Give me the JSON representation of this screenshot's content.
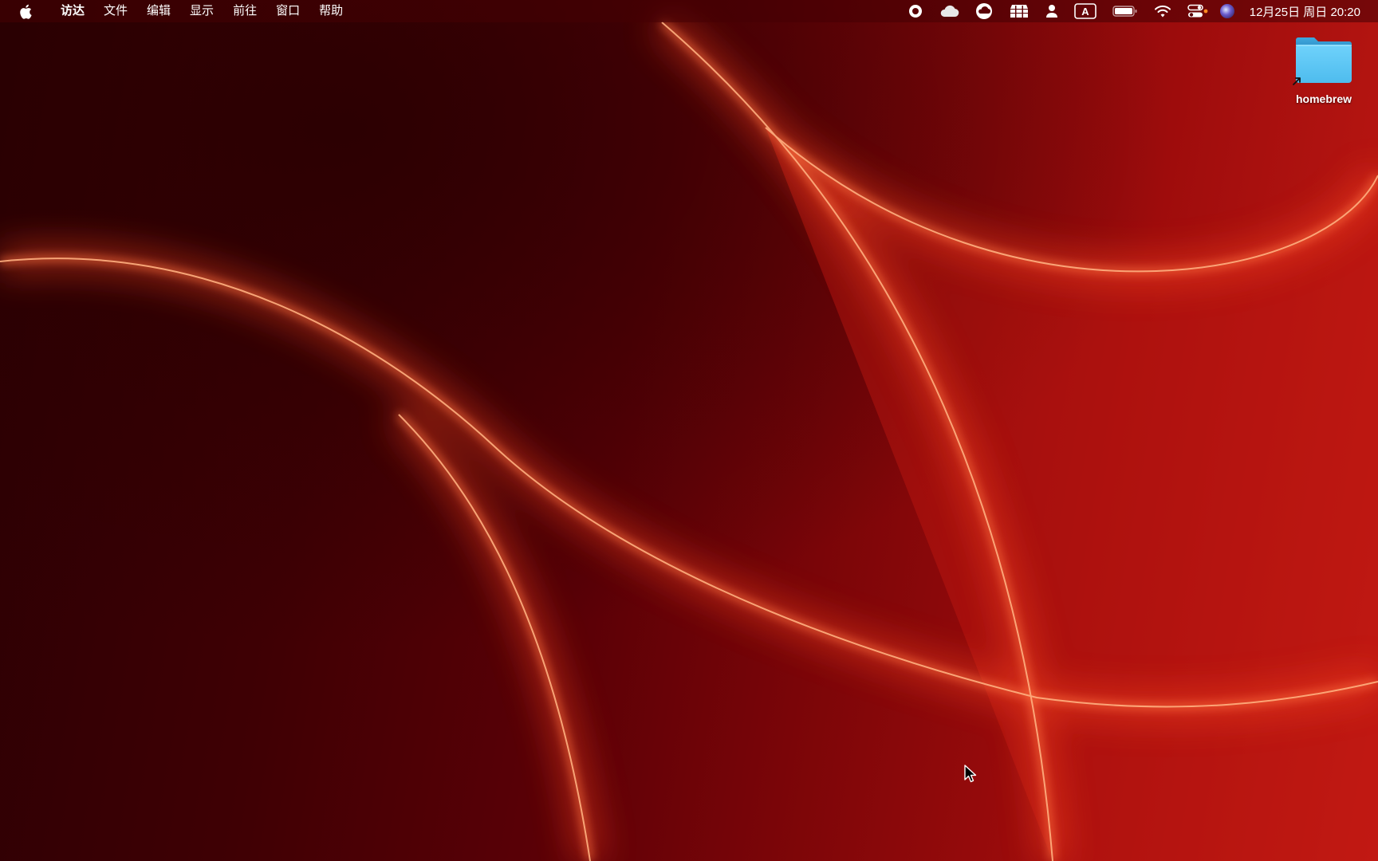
{
  "menubar": {
    "apple_icon": "apple-logo-icon",
    "app_name": "访达",
    "items": [
      "文件",
      "编辑",
      "显示",
      "前往",
      "窗口",
      "帮助"
    ],
    "status_icons": [
      "screen-record-icon",
      "cloud-icon",
      "cloud-upload-icon",
      "storage-icon",
      "user-icon",
      "input-source-icon",
      "battery-icon",
      "wifi-icon",
      "control-center-icon",
      "siri-icon"
    ],
    "input_source_label": "A",
    "clock": "12月25日 周日  20:20"
  },
  "desktop": {
    "icons": [
      {
        "label": "homebrew",
        "icon": "folder-alias-icon"
      }
    ]
  },
  "colors": {
    "wallpaper_dark": "#2a0003",
    "wallpaper_light": "#c21a14",
    "glow": "#ff6a3a",
    "folder": "#5ec8f5"
  }
}
